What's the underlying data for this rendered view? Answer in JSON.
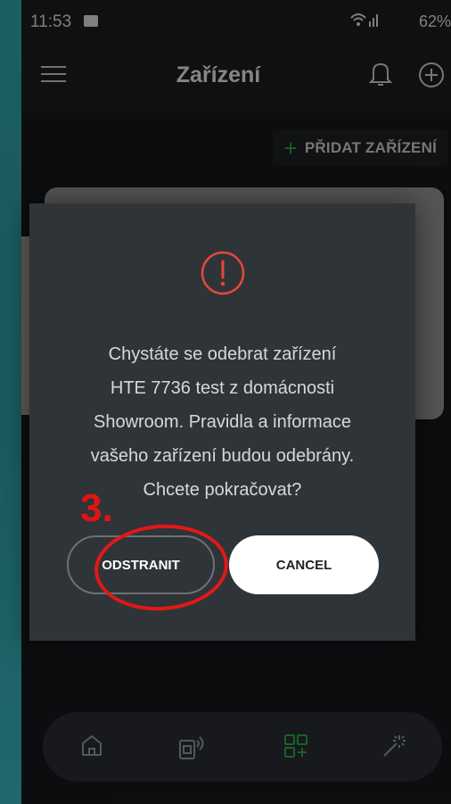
{
  "status_bar": {
    "time": "11:53",
    "battery": "62%"
  },
  "app_bar": {
    "title": "Zařízení"
  },
  "add_device": {
    "label": "PŘIDAT ZAŘÍZENÍ"
  },
  "dialog": {
    "message_lines": [
      "Chystáte se odebrat zařízení",
      "HTE 7736 test z domácnosti",
      "Showroom. Pravidla a informace",
      "vašeho zařízení budou odebrány.",
      "Chcete pokračovat?"
    ],
    "remove_label": "ODSTRANIT",
    "cancel_label": "CANCEL"
  },
  "annotation": {
    "step_number": "3."
  },
  "bottom_nav": {
    "items": [
      "home-icon",
      "devices-remote-icon",
      "grid-add-icon",
      "magic-wand-icon"
    ],
    "active_index": 2
  },
  "colors": {
    "accent_green": "#29b34a",
    "annotation_red": "#e01414"
  }
}
